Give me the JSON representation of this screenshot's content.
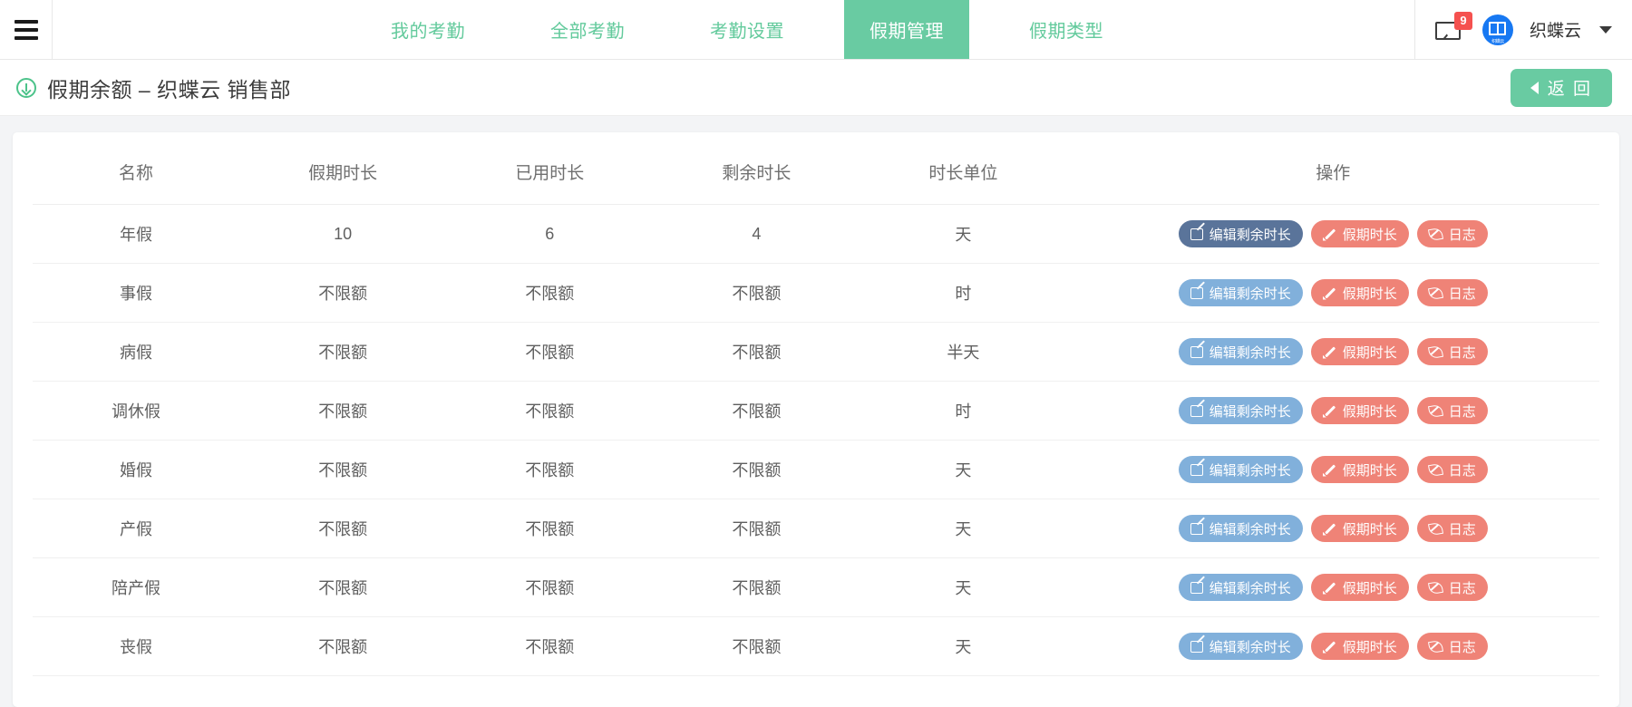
{
  "topbar": {
    "menu_icon": "hamburger-icon",
    "tabs": [
      {
        "label": "我的考勤",
        "active": false
      },
      {
        "label": "全部考勤",
        "active": false
      },
      {
        "label": "考勤设置",
        "active": false
      },
      {
        "label": "假期管理",
        "active": true
      },
      {
        "label": "假期类型",
        "active": false
      }
    ],
    "mail_icon": "envelope-icon",
    "mail_badge": "9",
    "avatar_label": "织蝶云",
    "user_name": "织蝶云",
    "caret_icon": "chevron-down-icon"
  },
  "page_header": {
    "icon": "download-circle-icon",
    "title": "假期余额 – 织蝶云 销售部",
    "back_label": "返 回",
    "back_icon": "chevron-left-icon"
  },
  "table": {
    "columns": [
      "名称",
      "假期时长",
      "已用时长",
      "剩余时长",
      "时长单位",
      "操作"
    ],
    "action_labels": {
      "edit_remaining": "编辑剩余时长",
      "leave_duration": "假期时长",
      "log": "日志"
    },
    "action_icons": {
      "edit_remaining": "edit-square-icon",
      "leave_duration": "pencil-icon",
      "log": "leaf-icon"
    },
    "rows": [
      {
        "name": "年假",
        "total": "10",
        "used": "6",
        "remaining": "4",
        "unit": "天",
        "highlighted": true
      },
      {
        "name": "事假",
        "total": "不限额",
        "used": "不限额",
        "remaining": "不限额",
        "unit": "时",
        "highlighted": false
      },
      {
        "name": "病假",
        "total": "不限额",
        "used": "不限额",
        "remaining": "不限额",
        "unit": "半天",
        "highlighted": false
      },
      {
        "name": "调休假",
        "total": "不限额",
        "used": "不限额",
        "remaining": "不限额",
        "unit": "时",
        "highlighted": false
      },
      {
        "name": "婚假",
        "total": "不限额",
        "used": "不限额",
        "remaining": "不限额",
        "unit": "天",
        "highlighted": false
      },
      {
        "name": "产假",
        "total": "不限额",
        "used": "不限额",
        "remaining": "不限额",
        "unit": "天",
        "highlighted": false
      },
      {
        "name": "陪产假",
        "total": "不限额",
        "used": "不限额",
        "remaining": "不限额",
        "unit": "天",
        "highlighted": false
      },
      {
        "name": "丧假",
        "total": "不限额",
        "used": "不限额",
        "remaining": "不限额",
        "unit": "天",
        "highlighted": false
      }
    ]
  },
  "colors": {
    "accent_green": "#69cba2",
    "tab_text_green": "#63ca9c",
    "badge_red": "#f5514f",
    "pill_blue": "#81b0db",
    "pill_blue_active": "#5a749a",
    "pill_red": "#ef8377",
    "avatar_blue": "#1778f2"
  }
}
